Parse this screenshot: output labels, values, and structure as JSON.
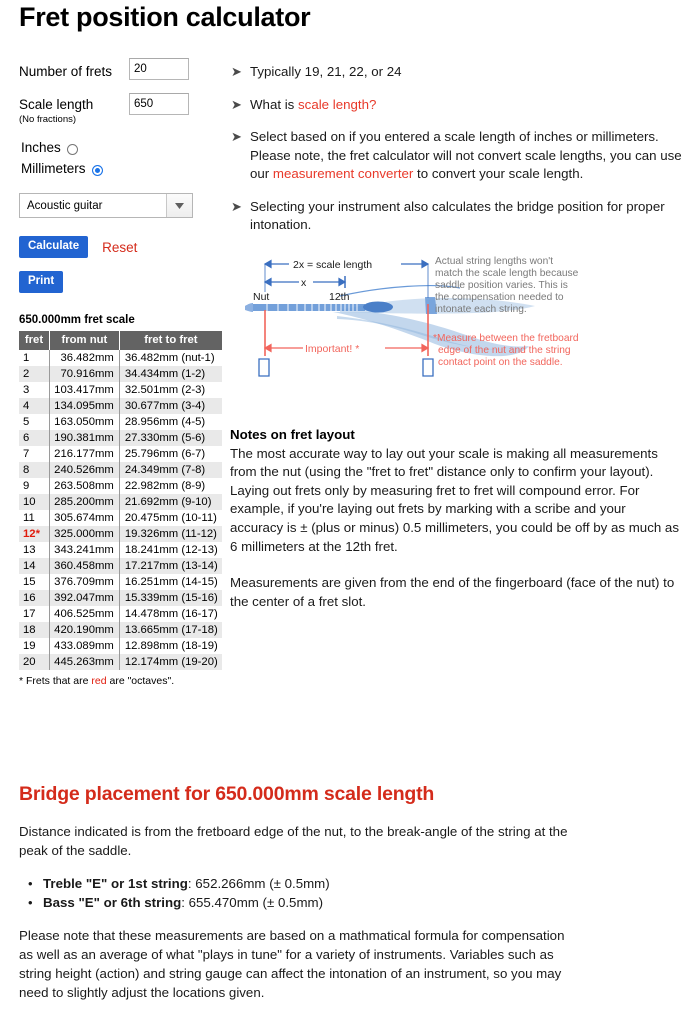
{
  "page_title": "Fret position calculator",
  "form": {
    "frets_label": "Number of frets",
    "frets_value": "20",
    "scale_label": "Scale length",
    "scale_sub": "(No fractions)",
    "scale_value": "650",
    "units": [
      {
        "label": "Inches",
        "checked": false
      },
      {
        "label": "Millimeters",
        "checked": true
      }
    ],
    "instrument_selected": "Acoustic guitar",
    "calculate_label": "Calculate",
    "reset_label": "Reset",
    "print_label": "Print"
  },
  "info_items": [
    {
      "prefix": "Typically 19, 21, 22, or 24",
      "link": "",
      "suffix": ""
    },
    {
      "prefix": "What is ",
      "link": "scale length?",
      "suffix": ""
    },
    {
      "prefix": "Select based on if you entered a scale length of inches or millimeters. Please note, the fret calculator will not convert scale lengths, you can use our ",
      "link": "measurement converter",
      "suffix": " to convert your scale length."
    },
    {
      "prefix": "Selecting your instrument also calculates the bridge position for proper intonation.",
      "link": "",
      "suffix": ""
    }
  ],
  "diagram": {
    "label_scale_length": "2x = scale length",
    "label_x": "x",
    "label_nut": "Nut",
    "label_12th": "12th",
    "label_important": "Important! *",
    "note_text": "Actual string lengths won't match the scale length because saddle position varies. This is the compensation needed to intonate each string.",
    "note_red": "* Measure between the fretboard edge of the nut  and the string contact point on the saddle.",
    "blue": "#5b8fd4",
    "red": "#f2655c"
  },
  "table": {
    "caption": "650.000mm fret scale",
    "headers": [
      "fret",
      "from nut",
      "fret to fret"
    ],
    "footnote_prefix": "* Frets that are ",
    "footnote_red": "red",
    "footnote_suffix": " are \"octaves\".",
    "rows": [
      {
        "fret": "1",
        "octave": false,
        "from_nut": "36.482mm",
        "fret_to_fret": "36.482mm (nut-1)"
      },
      {
        "fret": "2",
        "octave": false,
        "from_nut": "70.916mm",
        "fret_to_fret": "34.434mm (1-2)"
      },
      {
        "fret": "3",
        "octave": false,
        "from_nut": "103.417mm",
        "fret_to_fret": "32.501mm (2-3)"
      },
      {
        "fret": "4",
        "octave": false,
        "from_nut": "134.095mm",
        "fret_to_fret": "30.677mm (3-4)"
      },
      {
        "fret": "5",
        "octave": false,
        "from_nut": "163.050mm",
        "fret_to_fret": "28.956mm (4-5)"
      },
      {
        "fret": "6",
        "octave": false,
        "from_nut": "190.381mm",
        "fret_to_fret": "27.330mm (5-6)"
      },
      {
        "fret": "7",
        "octave": false,
        "from_nut": "216.177mm",
        "fret_to_fret": "25.796mm (6-7)"
      },
      {
        "fret": "8",
        "octave": false,
        "from_nut": "240.526mm",
        "fret_to_fret": "24.349mm (7-8)"
      },
      {
        "fret": "9",
        "octave": false,
        "from_nut": "263.508mm",
        "fret_to_fret": "22.982mm (8-9)"
      },
      {
        "fret": "10",
        "octave": false,
        "from_nut": "285.200mm",
        "fret_to_fret": "21.692mm (9-10)"
      },
      {
        "fret": "11",
        "octave": false,
        "from_nut": "305.674mm",
        "fret_to_fret": "20.475mm (10-11)"
      },
      {
        "fret": "12*",
        "octave": true,
        "from_nut": "325.000mm",
        "fret_to_fret": "19.326mm (11-12)"
      },
      {
        "fret": "13",
        "octave": false,
        "from_nut": "343.241mm",
        "fret_to_fret": "18.241mm (12-13)"
      },
      {
        "fret": "14",
        "octave": false,
        "from_nut": "360.458mm",
        "fret_to_fret": "17.217mm (13-14)"
      },
      {
        "fret": "15",
        "octave": false,
        "from_nut": "376.709mm",
        "fret_to_fret": "16.251mm (14-15)"
      },
      {
        "fret": "16",
        "octave": false,
        "from_nut": "392.047mm",
        "fret_to_fret": "15.339mm (15-16)"
      },
      {
        "fret": "17",
        "octave": false,
        "from_nut": "406.525mm",
        "fret_to_fret": "14.478mm (16-17)"
      },
      {
        "fret": "18",
        "octave": false,
        "from_nut": "420.190mm",
        "fret_to_fret": "13.665mm (17-18)"
      },
      {
        "fret": "19",
        "octave": false,
        "from_nut": "433.089mm",
        "fret_to_fret": "12.898mm (18-19)"
      },
      {
        "fret": "20",
        "octave": false,
        "from_nut": "445.263mm",
        "fret_to_fret": "12.174mm (19-20)"
      }
    ]
  },
  "notes": {
    "heading": "Notes on fret layout",
    "para1": "The most accurate way to lay out your scale is making all measurements from the nut (using the \"fret to fret\" distance only to confirm your layout). Laying out frets only by measuring fret to fret will compound error. For example, if you're laying out frets by marking with a scribe and your accuracy is ± (plus or minus) 0.5 millimeters, you could be off by as much as 6 millimeters at the 12th fret.",
    "para2": "Measurements are given from the end of the fingerboard (face of the nut) to the center of a fret slot."
  },
  "bridge": {
    "heading": "Bridge placement for 650.000mm scale length",
    "intro": "Distance indicated is from the fretboard edge of the nut, to the break-angle of the string at the peak of the saddle.",
    "items": [
      {
        "label": "Treble \"E\" or 1st string",
        "value": ": 652.266mm (± 0.5mm)"
      },
      {
        "label": "Bass \"E\" or 6th string",
        "value": ": 655.470mm (± 0.5mm)"
      }
    ],
    "outro": "Please note that these measurements are based on a mathmatical formula for compensation as well as an average of what \"plays in tune\" for a variety of instruments. Variables such as string height (action) and string gauge can affect the intonation of an instrument, so you may need to slightly adjust the locations given."
  }
}
